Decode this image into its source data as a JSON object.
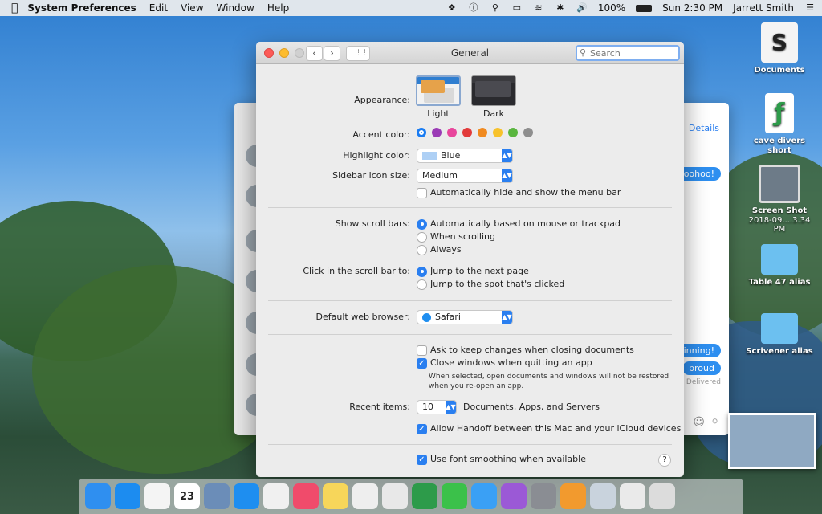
{
  "menubar": {
    "apple": "",
    "app_name": "System Preferences",
    "menus": [
      "Edit",
      "View",
      "Window",
      "Help"
    ],
    "battery": "100%",
    "clock": "Sun 2:30 PM",
    "user": "Jarrett Smith"
  },
  "desktop": {
    "icons": [
      {
        "label": "Documents",
        "sub": ""
      },
      {
        "label": "cave divers short",
        "sub": ""
      },
      {
        "label": "Screen Shot",
        "sub": "2018-09....3.34 PM"
      },
      {
        "label": "Table 47 alias",
        "sub": ""
      },
      {
        "label": "Scrivener alias",
        "sub": ""
      }
    ]
  },
  "messages": {
    "details": "Details",
    "bubbles": [
      "oohoo!",
      "inning!",
      "proud"
    ],
    "delivered": "Delivered"
  },
  "window": {
    "title": "General",
    "search_placeholder": "Search"
  },
  "appearance": {
    "label": "Appearance:",
    "options": [
      "Light",
      "Dark"
    ]
  },
  "accent": {
    "label": "Accent color:",
    "colors": [
      "#1a7cf2",
      "#9b3bb6",
      "#e8469c",
      "#e23b3b",
      "#f08a20",
      "#f7c22c",
      "#5ab63f",
      "#8e8e8e"
    ]
  },
  "highlight": {
    "label": "Highlight color:",
    "value": "Blue",
    "swatch": "#aed0f5"
  },
  "sidebar_icon": {
    "label": "Sidebar icon size:",
    "value": "Medium"
  },
  "menubar_hide": {
    "label": "Automatically hide and show the menu bar",
    "checked": false
  },
  "scroll_bars": {
    "label": "Show scroll bars:",
    "options": [
      "Automatically based on mouse or trackpad",
      "When scrolling",
      "Always"
    ],
    "selected": 0
  },
  "scroll_click": {
    "label": "Click in the scroll bar to:",
    "options": [
      "Jump to the next page",
      "Jump to the spot that's clicked"
    ],
    "selected": 0
  },
  "browser": {
    "label": "Default web browser:",
    "value": "Safari"
  },
  "ask_keep": {
    "label": "Ask to keep changes when closing documents",
    "checked": false
  },
  "close_windows": {
    "label": "Close windows when quitting an app",
    "checked": true,
    "note": "When selected, open documents and windows will not be restored when you re-open an app."
  },
  "recent": {
    "label": "Recent items:",
    "value": "10",
    "suffix": "Documents, Apps, and Servers"
  },
  "handoff": {
    "label": "Allow Handoff between this Mac and your iCloud devices",
    "checked": true
  },
  "font_smoothing": {
    "label": "Use font smoothing when available",
    "checked": true
  },
  "help": "?",
  "dock": {
    "calendar_day": "23",
    "apps": [
      {
        "name": "finder",
        "color": "#2f8ff0"
      },
      {
        "name": "app-store",
        "color": "#1c8cf0"
      },
      {
        "name": "reminders",
        "color": "#f4f4f4"
      },
      {
        "name": "calendar",
        "color": "#ffffff"
      },
      {
        "name": "preview",
        "color": "#6b8db8"
      },
      {
        "name": "safari",
        "color": "#1e8ef0"
      },
      {
        "name": "photos",
        "color": "#f0f0f0"
      },
      {
        "name": "music",
        "color": "#f04b6b"
      },
      {
        "name": "notes",
        "color": "#f7d65a"
      },
      {
        "name": "textedit",
        "color": "#eeeeee"
      },
      {
        "name": "scrivener",
        "color": "#e8e8e8"
      },
      {
        "name": "feedback",
        "color": "#2d9b4a"
      },
      {
        "name": "facetime",
        "color": "#3bc14a"
      },
      {
        "name": "messages",
        "color": "#3aa0f5"
      },
      {
        "name": "feedback-assistant",
        "color": "#9b59d6"
      },
      {
        "name": "system-preferences",
        "color": "#8a8d93"
      },
      {
        "name": "home",
        "color": "#f29a2e"
      },
      {
        "name": "utility",
        "color": "#c9d3dd"
      },
      {
        "name": "installer",
        "color": "#eaeaea"
      },
      {
        "name": "trash",
        "color": "#dcdcdc"
      }
    ]
  }
}
